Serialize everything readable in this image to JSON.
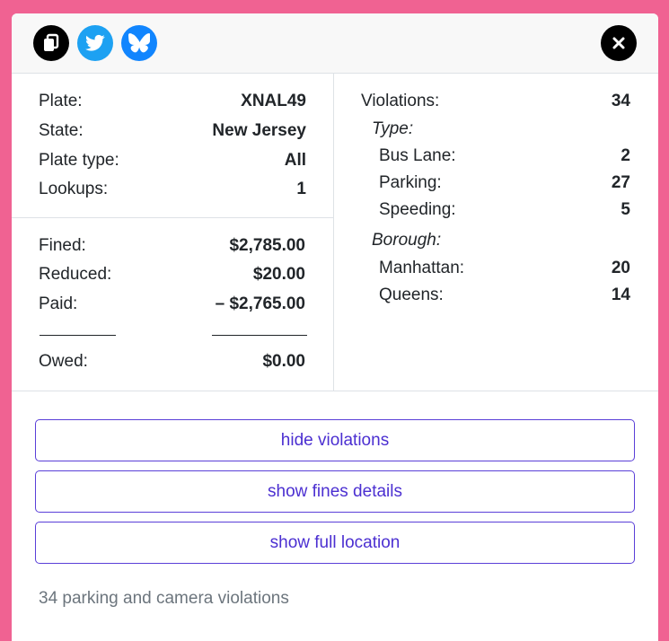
{
  "plate_info": {
    "plate_label": "Plate:",
    "plate_value": "XNAL49",
    "state_label": "State:",
    "state_value": "New Jersey",
    "plate_type_label": "Plate type:",
    "plate_type_value": "All",
    "lookups_label": "Lookups:",
    "lookups_value": "1"
  },
  "fines": {
    "fined_label": "Fined:",
    "fined_value": "$2,785.00",
    "reduced_label": "Reduced:",
    "reduced_value": "$20.00",
    "paid_label": "Paid:",
    "paid_value": "– $2,765.00",
    "owed_label": "Owed:",
    "owed_value": "$0.00"
  },
  "violations": {
    "label": "Violations:",
    "total": "34",
    "type_heading": "Type:",
    "types": [
      {
        "label": "Bus Lane:",
        "value": "2"
      },
      {
        "label": "Parking:",
        "value": "27"
      },
      {
        "label": "Speeding:",
        "value": "5"
      }
    ],
    "borough_heading": "Borough:",
    "boroughs": [
      {
        "label": "Manhattan:",
        "value": "20"
      },
      {
        "label": "Queens:",
        "value": "14"
      }
    ]
  },
  "actions": {
    "hide_violations": "hide violations",
    "show_fines_details": "show fines details",
    "show_full_location": "show full location"
  },
  "footer": {
    "summary": "34 parking and camera violations"
  },
  "colors": {
    "background": "#f06292",
    "twitter": "#1da1f2",
    "bluesky": "#1185fe",
    "button_accent": "#4b2fd1"
  },
  "icons": {
    "copy": "copy-icon",
    "twitter": "twitter-icon",
    "bluesky": "bluesky-icon",
    "close": "close-icon"
  }
}
